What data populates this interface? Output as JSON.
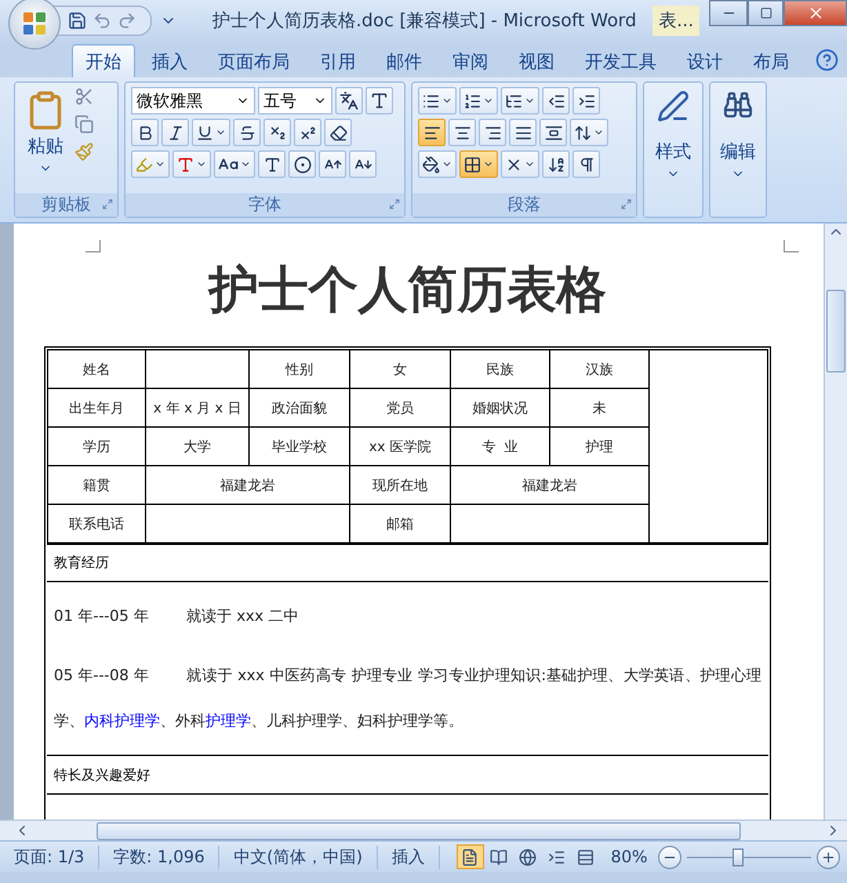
{
  "window": {
    "title": "护士个人简历表格.doc [兼容模式] - Microsoft Word",
    "context_title": "表..."
  },
  "tabs": [
    {
      "label": "开始",
      "selected": true
    },
    {
      "label": "插入",
      "selected": false
    },
    {
      "label": "页面布局",
      "selected": false
    },
    {
      "label": "引用",
      "selected": false
    },
    {
      "label": "邮件",
      "selected": false
    },
    {
      "label": "审阅",
      "selected": false
    },
    {
      "label": "视图",
      "selected": false
    },
    {
      "label": "开发工具",
      "selected": false
    },
    {
      "label": "设计",
      "selected": false
    },
    {
      "label": "布局",
      "selected": false
    }
  ],
  "ribbon": {
    "clipboard": {
      "paste": "粘贴",
      "label": "剪贴板"
    },
    "font": {
      "font_name": "微软雅黑",
      "font_size": "五号",
      "label": "字体"
    },
    "paragraph": {
      "label": "段落",
      "align_buttons": [
        {
          "selected": true
        },
        {
          "selected": false
        },
        {
          "selected": false
        },
        {
          "selected": false
        },
        {
          "selected": false
        }
      ],
      "borders_active": true
    },
    "styles": {
      "label": "样式"
    },
    "editing": {
      "label": "编辑"
    }
  },
  "document": {
    "heading": "护士个人简历表格",
    "info_rows": [
      [
        {
          "kind": "text",
          "text": "姓名"
        },
        {
          "kind": "empty"
        },
        {
          "kind": "text",
          "text": "性别"
        },
        {
          "kind": "text",
          "text": "女"
        },
        {
          "kind": "text",
          "text": "民族"
        },
        {
          "kind": "text",
          "text": "汉族"
        }
      ],
      [
        {
          "kind": "text",
          "text": "出生年月"
        },
        {
          "kind": "text",
          "text": "x 年 x 月 x 日"
        },
        {
          "kind": "text",
          "text": "政治面貌"
        },
        {
          "kind": "text",
          "text": "党员"
        },
        {
          "kind": "text",
          "text": "婚姻状况"
        },
        {
          "kind": "text",
          "text": "未"
        }
      ],
      [
        {
          "kind": "text",
          "text": "学历"
        },
        {
          "kind": "text",
          "text": "大学"
        },
        {
          "kind": "text",
          "text": "毕业学校"
        },
        {
          "kind": "text",
          "text": "xx 医学院"
        },
        {
          "kind": "text",
          "text": "专  业"
        },
        {
          "kind": "text",
          "text": "护理"
        }
      ],
      [
        {
          "kind": "text",
          "text": "籍贯"
        },
        {
          "kind": "wide",
          "text": "福建龙岩"
        },
        {
          "kind": "text",
          "text": "现所在地"
        },
        {
          "kind": "wide",
          "text": "福建龙岩"
        }
      ],
      [
        {
          "kind": "text",
          "text": "联系电话"
        },
        {
          "kind": "wide_empty"
        },
        {
          "kind": "text",
          "text": "邮箱"
        },
        {
          "kind": "wide_empty"
        }
      ]
    ],
    "education": {
      "heading": "教育经历",
      "entries": [
        {
          "period": "01 年---05 年",
          "segments": [
            {
              "text": "就读于 xxx 二中",
              "highlight": false
            }
          ]
        },
        {
          "period": "05 年---08 年",
          "segments": [
            {
              "text": "就读于 xxx 中医药高专  护理专业  学习专业护理知识:基础护理、大学英语、护理心理学、",
              "highlight": false
            },
            {
              "text": "内科护理学",
              "highlight": true
            },
            {
              "text": "、外科",
              "highlight": false
            },
            {
              "text": "护理学",
              "highlight": true
            },
            {
              "text": "、儿科护理学、妇科护理学等。",
              "highlight": false
            }
          ]
        }
      ]
    },
    "skills_heading": "特长及兴趣爱好"
  },
  "status_bar": {
    "page": "页面: 1/3",
    "words": "字数: 1,096",
    "language": "中文(简体，中国)",
    "mode": "插入",
    "views": [
      {
        "selected": true
      },
      {
        "selected": false
      },
      {
        "selected": false
      },
      {
        "selected": false
      },
      {
        "selected": false
      }
    ],
    "zoom": "80%",
    "zoom_level": {
      "level": 0.4
    }
  }
}
